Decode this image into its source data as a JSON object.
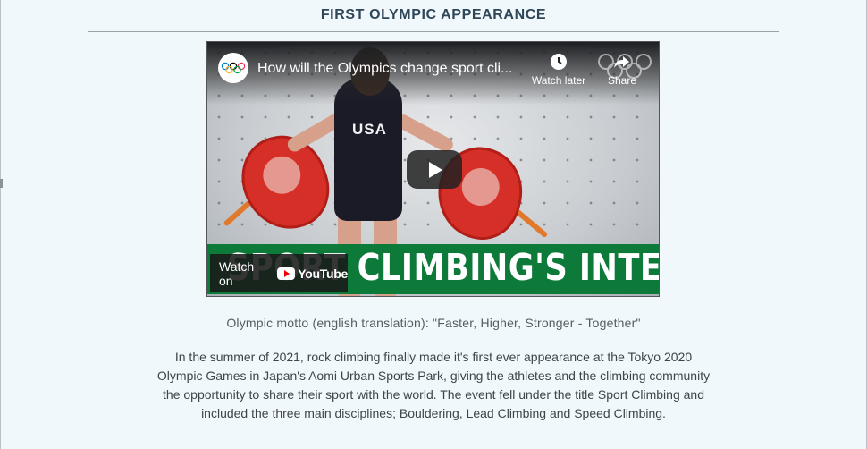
{
  "section": {
    "title": "FIRST OLYMPIC APPEARANCE"
  },
  "video": {
    "title": "How will the Olympics change sport cli...",
    "watch_later_label": "Watch later",
    "share_label": "Share",
    "watch_on_label": "Watch on",
    "youtube_label": "YouTube",
    "banner_text": "SPORT CLIMBING'S INTERVIEW",
    "jersey_text": "USA",
    "channel_icon": "olympic-rings-icon",
    "play_icon": "play-icon"
  },
  "caption": "Olympic motto (english translation): \"Faster, Higher, Stronger - Together\"",
  "paragraph": "In the summer of 2021, rock climbing finally made it's first ever appearance at the Tokyo 2020 Olympic Games in Japan's Aomi Urban Sports Park, giving the athletes and the climbing community the opportunity to share their sport with the world. The event fell under the title Sport Climbing and included the three main disciplines; Bouldering, Lead Climbing and Speed Climbing.",
  "colors": {
    "title": "#2f4658",
    "background": "#f0f8fc",
    "banner": "#0e7a3a",
    "hold": "#d62f28"
  }
}
